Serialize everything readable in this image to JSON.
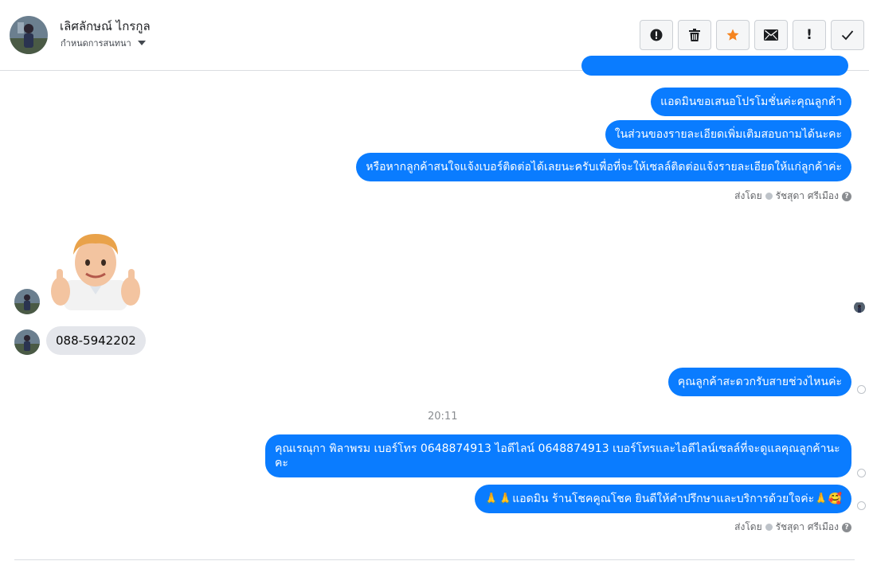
{
  "header": {
    "contact_name": "เลิศลักษณ์ ไกรกูล",
    "subtitle": "กำหนดการสนทนา",
    "toolbar": [
      {
        "name": "alert-circle-icon",
        "label": "!"
      },
      {
        "name": "trash-icon",
        "label": ""
      },
      {
        "name": "star-icon",
        "label": ""
      },
      {
        "name": "envelope-icon",
        "label": ""
      },
      {
        "name": "exclamation-icon",
        "label": "!"
      },
      {
        "name": "checkmark-icon",
        "label": "✓"
      }
    ]
  },
  "colors": {
    "outgoing_bubble": "#0a7cff",
    "incoming_bubble": "#e4e6eb",
    "star": "#f5841f"
  },
  "messages": {
    "out1": "แอดมินขอเสนอโปรโมชั่นค่ะคุณลูกค้า",
    "out2": "ในส่วนของรายละเอียดเพิ่มเติมสอบถามได้นะคะ",
    "out3": "หรือหากลูกค้าสนใจแจ้งเบอร์ติดต่อได้เลยนะครับเพื่อที่จะให้เซลล์ติดต่อแจ้งรายละเอียดให้แก่ลูกค้าค่ะ",
    "sent_by_1": "ส่งโดย",
    "sender_1": "รัชสุดา ศรีเมือง",
    "in_phone": "088-5942202",
    "out4": "คุณลูกค้าสะดวกรับสายช่วงไหนค่ะ",
    "time": "20:11",
    "out5": "คุณเรณุกา พิลาพรม        เบอร์โทร 0648874913  ไอดีไลน์ 0648874913   เบอร์โทรและไอดีไลน์เซลล์ที่จะดูแลคุณลูกค้านะคะ",
    "out6": "🙏🙏แอดมิน ร้านโชคคูณโชค ยินดีให้คำปรึกษาและบริการด้วยใจค่ะ🙏🥰",
    "sent_by_2": "ส่งโดย",
    "sender_2": "รัชสุดา ศรีเมือง"
  }
}
